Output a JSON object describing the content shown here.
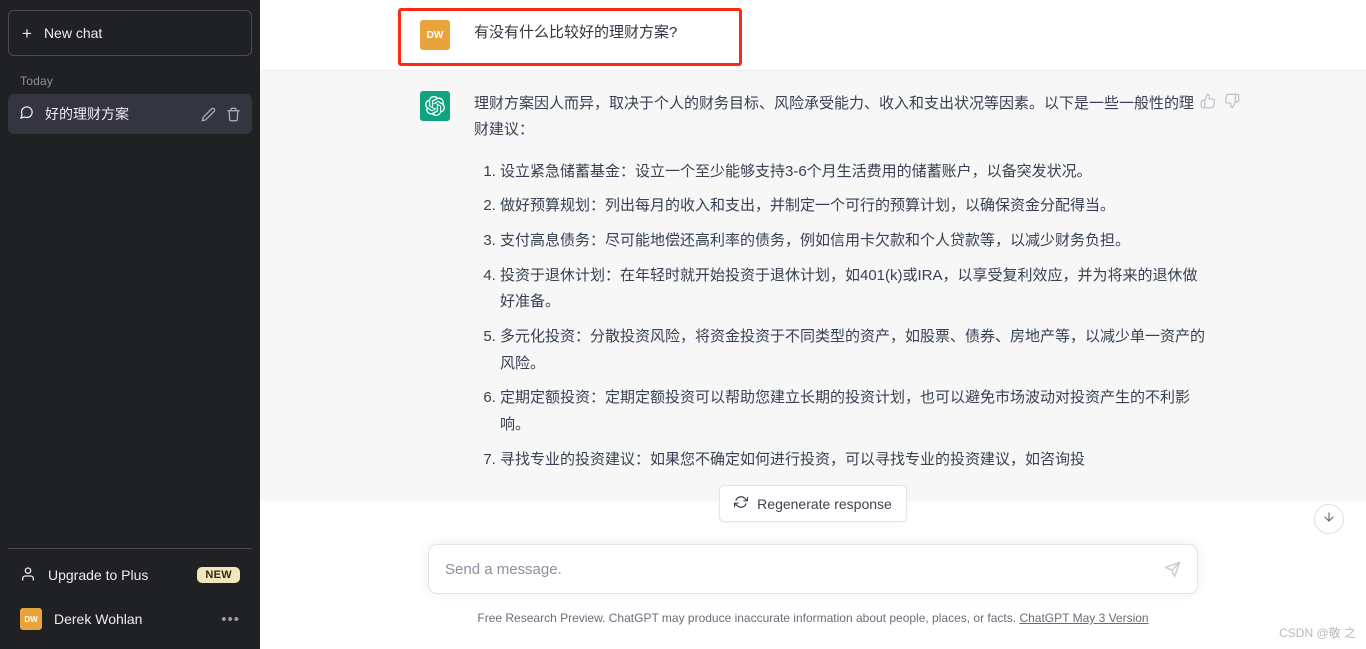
{
  "sidebar": {
    "new_chat_label": "New chat",
    "new_chat_icon": "plus-icon",
    "section_label": "Today",
    "chats": [
      {
        "title": "好的理财方案",
        "icon": "chat-bubble-icon",
        "edit_icon": "pencil-icon",
        "delete_icon": "trash-icon"
      }
    ],
    "upgrade": {
      "label": "Upgrade to Plus",
      "badge": "NEW",
      "icon": "person-icon"
    },
    "account": {
      "name": "Derek Wohlan",
      "initials": "DW",
      "menu_icon": "ellipsis-icon",
      "avatar_color": "#e8a33d"
    }
  },
  "conversation": {
    "user_message": {
      "initials": "DW",
      "text": "有没有什么比较好的理财方案?"
    },
    "assistant_message": {
      "avatar_icon": "openai-logo-icon",
      "intro": "理财方案因人而异，取决于个人的财务目标、风险承受能力、收入和支出状况等因素。以下是一些一般性的理财建议：",
      "items": [
        "设立紧急储蓄基金：设立一个至少能够支持3-6个月生活费用的储蓄账户，以备突发状况。",
        "做好预算规划：列出每月的收入和支出，并制定一个可行的预算计划，以确保资金分配得当。",
        "支付高息债务：尽可能地偿还高利率的债务，例如信用卡欠款和个人贷款等，以减少财务负担。",
        "投资于退休计划：在年轻时就开始投资于退休计划，如401(k)或IRA，以享受复利效应，并为将来的退休做好准备。",
        "多元化投资：分散投资风险，将资金投资于不同类型的资产，如股票、债券、房地产等，以减少单一资产的风险。",
        "定期定额投资：定期定额投资可以帮助您建立长期的投资计划，也可以避免市场波动对投资产生的不利影响。",
        "寻找专业的投资建议：如果您不确定如何进行投资，可以寻找专业的投资建议，如咨询投"
      ],
      "actions": [
        {
          "name": "copy-icon"
        },
        {
          "name": "thumbs-up-icon"
        },
        {
          "name": "thumbs-down-icon"
        }
      ]
    }
  },
  "regenerate": {
    "label": "Regenerate response",
    "icon": "refresh-icon"
  },
  "composer": {
    "placeholder": "Send a message.",
    "value": "",
    "send_icon": "send-icon"
  },
  "scroll_button": {
    "icon": "arrow-down-icon"
  },
  "footer": {
    "text": "Free Research Preview. ChatGPT may produce inaccurate information about people, places, or facts.",
    "link": "ChatGPT May 3 Version"
  },
  "watermark": "CSDN @敬 之",
  "colors": {
    "sidebar_bg": "#202123",
    "accent_green": "#10a37f",
    "avatar_orange": "#e8a33d",
    "annotation_red": "#fa2a16",
    "assistant_bg": "#f7f7f8"
  }
}
